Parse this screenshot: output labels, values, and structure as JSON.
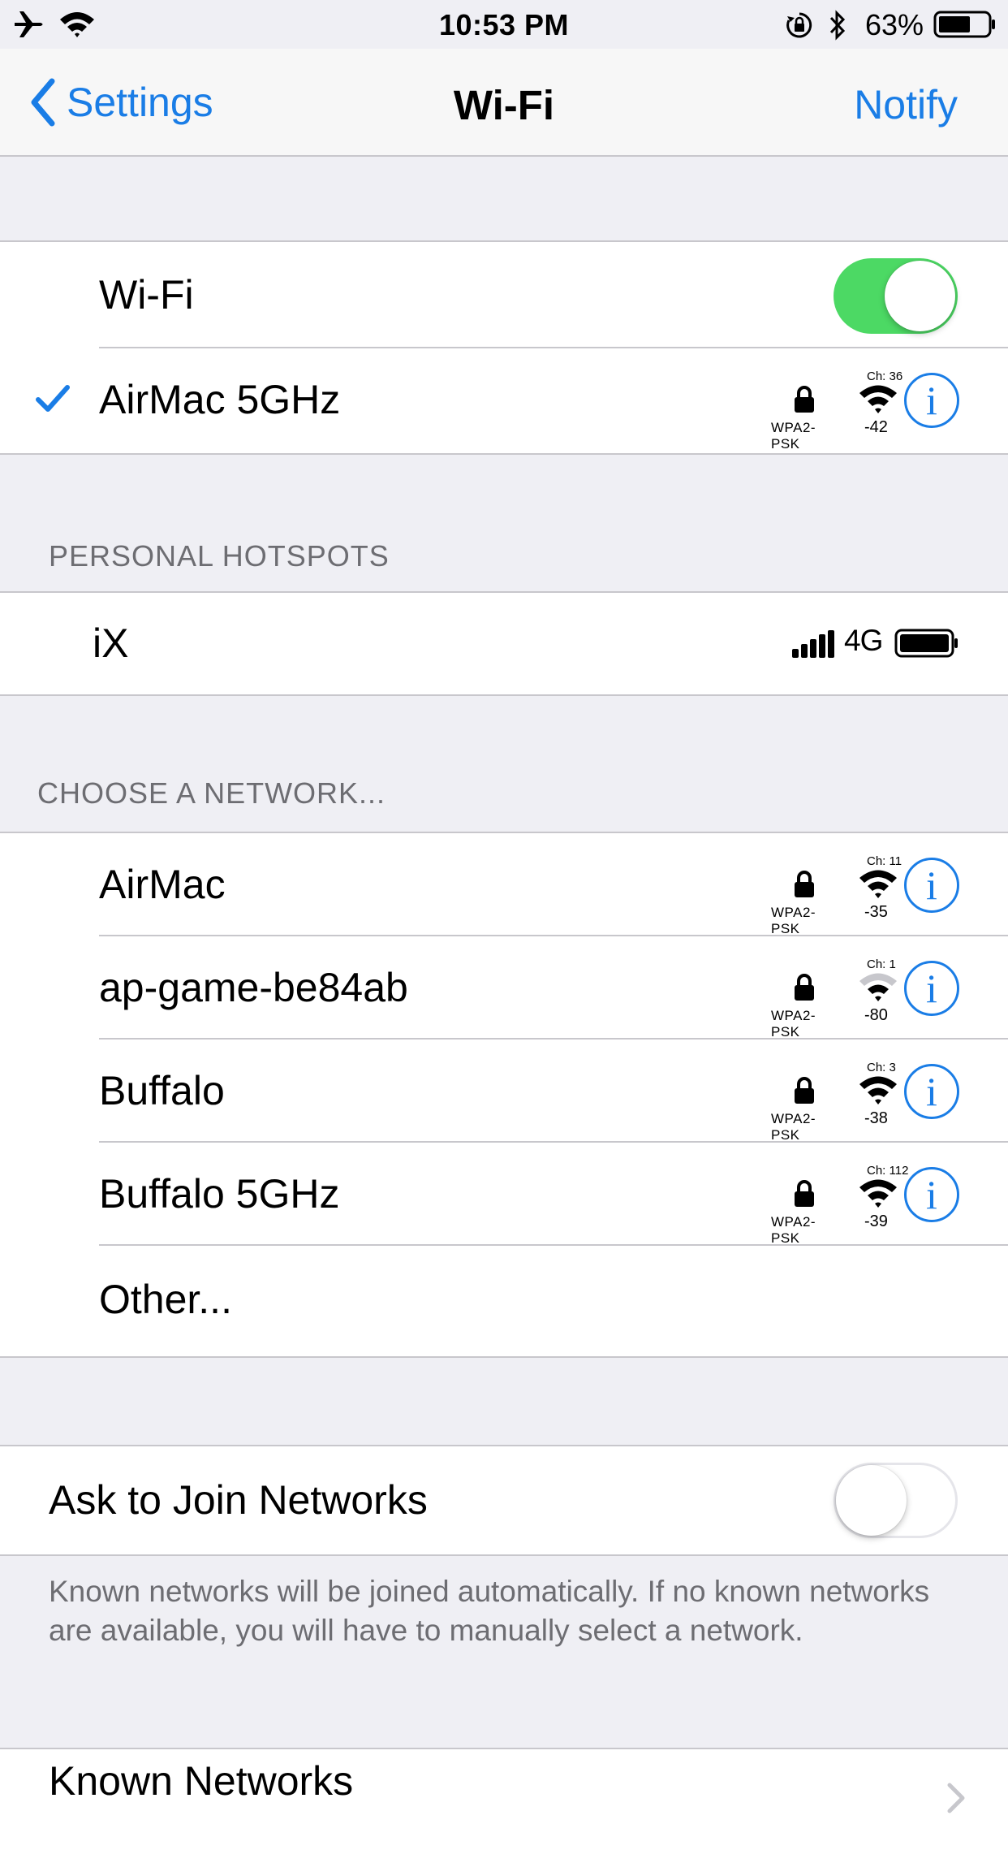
{
  "status_bar": {
    "time": "10:53 PM",
    "battery_percent": "63%"
  },
  "nav": {
    "back_label": "Settings",
    "title": "Wi-Fi",
    "right_label": "Notify"
  },
  "wifi_toggle": {
    "label": "Wi-Fi",
    "on": true
  },
  "current_network": {
    "name": "AirMac 5GHz",
    "security": "WPA2-PSK",
    "channel": "Ch: 36",
    "rssi": "-42"
  },
  "hotspots": {
    "header": "PERSONAL HOTSPOTS",
    "items": [
      {
        "name": "iX",
        "network_type": "4G"
      }
    ]
  },
  "choose": {
    "header": "CHOOSE A NETWORK...",
    "networks": [
      {
        "name": "AirMac",
        "security": "WPA2-PSK",
        "channel": "Ch: 11",
        "rssi": "-35"
      },
      {
        "name": "ap-game-be84ab",
        "security": "WPA2-PSK",
        "channel": "Ch: 1",
        "rssi": "-80"
      },
      {
        "name": "Buffalo",
        "security": "WPA2-PSK",
        "channel": "Ch: 3",
        "rssi": "-38"
      },
      {
        "name": "Buffalo 5GHz",
        "security": "WPA2-PSK",
        "channel": "Ch: 112",
        "rssi": "-39"
      }
    ],
    "other_label": "Other..."
  },
  "ask_to_join": {
    "label": "Ask to Join Networks",
    "on": false,
    "footer": "Known networks will be joined automatically. If no known networks are available, you will have to manually select a network."
  },
  "known_networks": {
    "label": "Known Networks"
  },
  "colors": {
    "accent": "#1a7de6",
    "toggle_on": "#4cd964",
    "background": "#efeff4"
  }
}
